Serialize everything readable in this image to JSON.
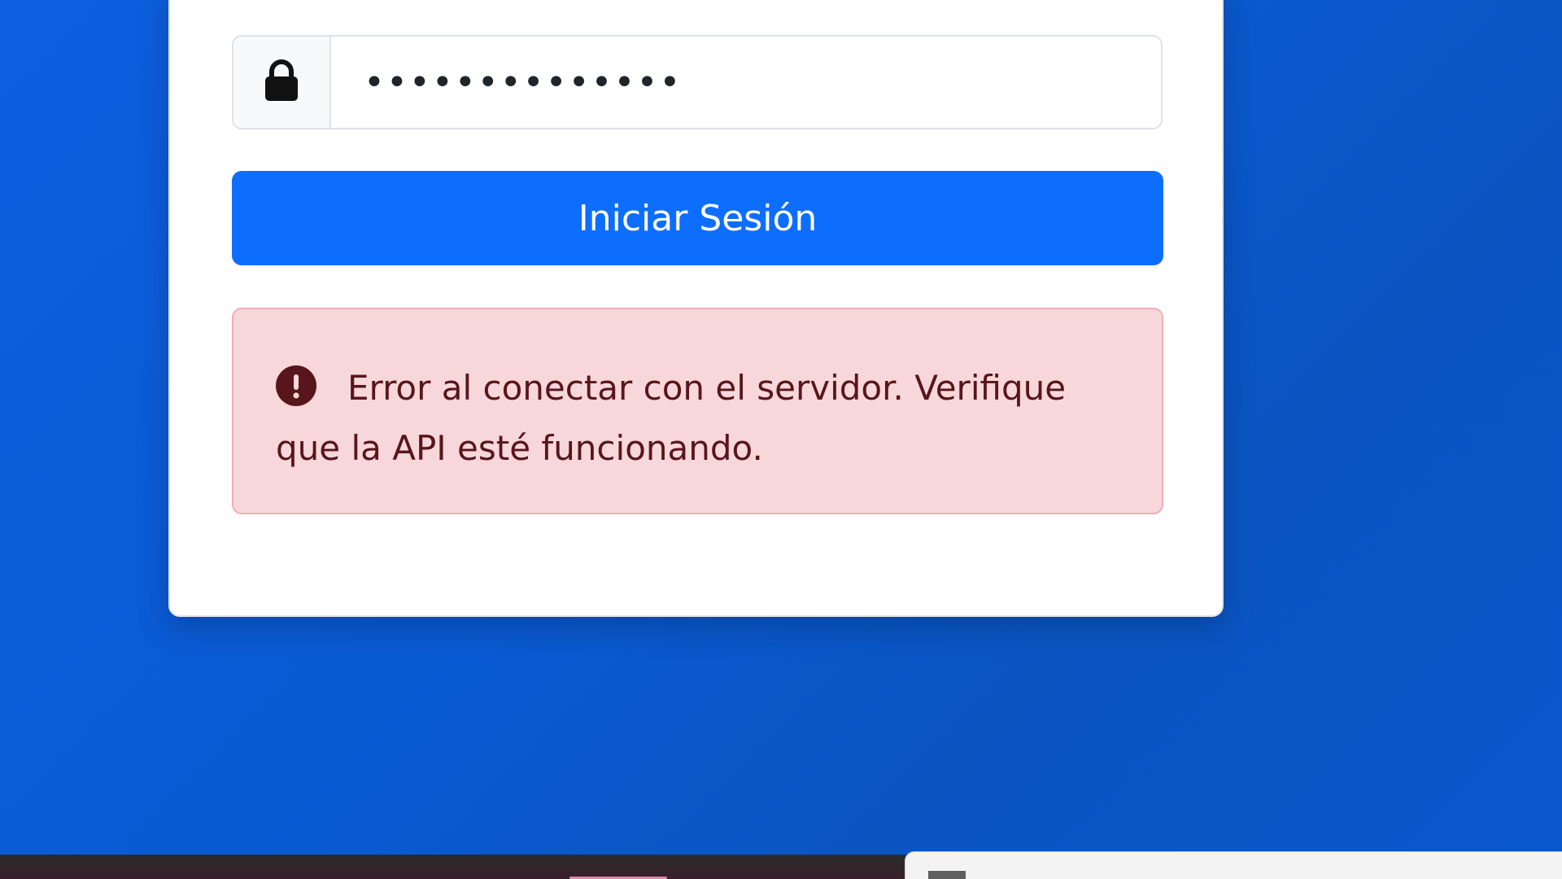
{
  "login_form": {
    "password_value": "••••••••••••••",
    "submit_label": "Iniciar Sesión",
    "error_message": "Error al conectar con el servidor. Verifique que la API esté funcionando."
  },
  "icons": {
    "password_addon": "lock-icon",
    "error": "exclamation-circle-icon"
  },
  "colors": {
    "background": "#0a5ad3",
    "primary_button": "#0d6efd",
    "alert_background": "#f8d7da",
    "alert_border": "#f1aeb5",
    "alert_text": "#58151c"
  }
}
